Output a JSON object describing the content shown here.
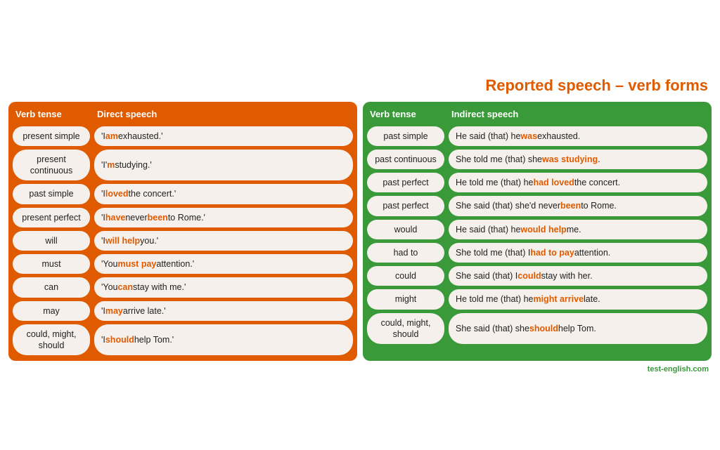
{
  "title": "Reported speech – verb forms",
  "direct": {
    "col1_header": "Verb tense",
    "col2_header": "Direct speech",
    "rows": [
      {
        "verb": "present simple",
        "speech_parts": [
          {
            "text": "'I ",
            "style": "normal"
          },
          {
            "text": "am",
            "style": "orange"
          },
          {
            "text": " exhausted.'",
            "style": "normal"
          }
        ]
      },
      {
        "verb": "present continuous",
        "speech_parts": [
          {
            "text": "'I'",
            "style": "normal"
          },
          {
            "text": "m",
            "style": "orange"
          },
          {
            "text": " studying.'",
            "style": "normal"
          }
        ]
      },
      {
        "verb": "past simple",
        "speech_parts": [
          {
            "text": "'I ",
            "style": "normal"
          },
          {
            "text": "loved",
            "style": "orange"
          },
          {
            "text": " the concert.'",
            "style": "normal"
          }
        ]
      },
      {
        "verb": "present perfect",
        "speech_parts": [
          {
            "text": "'I ",
            "style": "normal"
          },
          {
            "text": "have",
            "style": "orange"
          },
          {
            "text": " never ",
            "style": "normal"
          },
          {
            "text": "been",
            "style": "orange"
          },
          {
            "text": " to Rome.'",
            "style": "normal"
          }
        ]
      },
      {
        "verb": "will",
        "speech_parts": [
          {
            "text": "'I ",
            "style": "normal"
          },
          {
            "text": "will help",
            "style": "orange"
          },
          {
            "text": " you.'",
            "style": "normal"
          }
        ]
      },
      {
        "verb": "must",
        "speech_parts": [
          {
            "text": "'You ",
            "style": "normal"
          },
          {
            "text": "must pay",
            "style": "orange"
          },
          {
            "text": " attention.'",
            "style": "normal"
          }
        ]
      },
      {
        "verb": "can",
        "speech_parts": [
          {
            "text": "'You ",
            "style": "normal"
          },
          {
            "text": "can",
            "style": "orange"
          },
          {
            "text": " stay with me.'",
            "style": "normal"
          }
        ]
      },
      {
        "verb": "may",
        "speech_parts": [
          {
            "text": "'I ",
            "style": "normal"
          },
          {
            "text": "may",
            "style": "orange"
          },
          {
            "text": " arrive late.'",
            "style": "normal"
          }
        ]
      },
      {
        "verb": "could, might, should",
        "speech_parts": [
          {
            "text": "'I ",
            "style": "normal"
          },
          {
            "text": "should",
            "style": "orange"
          },
          {
            "text": " help Tom.'",
            "style": "normal"
          }
        ]
      }
    ]
  },
  "indirect": {
    "col1_header": "Verb tense",
    "col2_header": "Indirect speech",
    "rows": [
      {
        "verb": "past simple",
        "speech_parts": [
          {
            "text": "He said (that) he ",
            "style": "normal"
          },
          {
            "text": "was",
            "style": "orange"
          },
          {
            "text": " exhausted.",
            "style": "normal"
          }
        ]
      },
      {
        "verb": "past continuous",
        "speech_parts": [
          {
            "text": "She told me (that) she ",
            "style": "normal"
          },
          {
            "text": "was studying",
            "style": "orange"
          },
          {
            "text": ".",
            "style": "normal"
          }
        ]
      },
      {
        "verb": "past perfect",
        "speech_parts": [
          {
            "text": "He told me (that) he ",
            "style": "normal"
          },
          {
            "text": "had loved",
            "style": "orange"
          },
          {
            "text": " the concert.",
            "style": "normal"
          }
        ]
      },
      {
        "verb": "past perfect",
        "speech_parts": [
          {
            "text": "She said (that) she'd never ",
            "style": "normal"
          },
          {
            "text": "been",
            "style": "orange"
          },
          {
            "text": " to Rome.",
            "style": "normal"
          }
        ]
      },
      {
        "verb": "would",
        "speech_parts": [
          {
            "text": "He said (that) he ",
            "style": "normal"
          },
          {
            "text": "would help",
            "style": "orange"
          },
          {
            "text": " me.",
            "style": "normal"
          }
        ]
      },
      {
        "verb": "had to",
        "speech_parts": [
          {
            "text": "She told me (that) I ",
            "style": "normal"
          },
          {
            "text": "had to pay",
            "style": "orange"
          },
          {
            "text": " attention.",
            "style": "normal"
          }
        ]
      },
      {
        "verb": "could",
        "speech_parts": [
          {
            "text": "She said (that) I ",
            "style": "normal"
          },
          {
            "text": "could",
            "style": "orange"
          },
          {
            "text": " stay with her.",
            "style": "normal"
          }
        ]
      },
      {
        "verb": "might",
        "speech_parts": [
          {
            "text": "He told me (that) he ",
            "style": "normal"
          },
          {
            "text": "might arrive",
            "style": "orange"
          },
          {
            "text": " late.",
            "style": "normal"
          }
        ]
      },
      {
        "verb": "could, might, should",
        "speech_parts": [
          {
            "text": "She said (that) she ",
            "style": "normal"
          },
          {
            "text": "should",
            "style": "orange"
          },
          {
            "text": " help Tom.",
            "style": "normal"
          }
        ]
      }
    ]
  },
  "footer": "test-english.com"
}
